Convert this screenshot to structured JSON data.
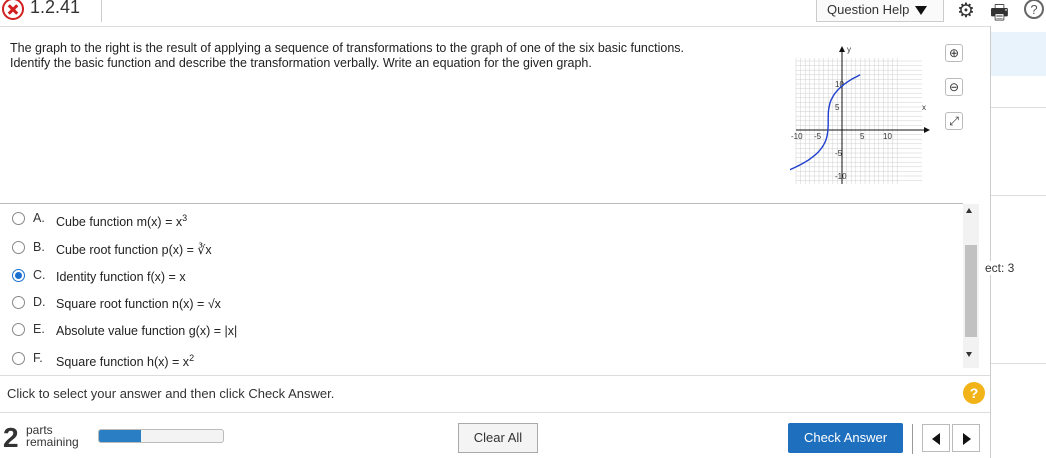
{
  "header": {
    "question_number": "1.2.41",
    "question_help": "Question Help"
  },
  "question": {
    "line1": "The graph to the right is the result of applying a sequence of transformations to the graph of one of the six basic functions.",
    "line2": "Identify the basic function and describe the transformation verbally. Write an equation for the given graph."
  },
  "graph": {
    "x_label": "x",
    "y_label": "y",
    "x_ticks": [
      "-10",
      "-5",
      "5",
      "10"
    ],
    "y_ticks": [
      "10",
      "5",
      "-5",
      "-10"
    ],
    "curve_color": "#1f3fd0"
  },
  "options": [
    {
      "letter": "A.",
      "text": "Cube function m(x) = x",
      "sup": "3",
      "selected": false
    },
    {
      "letter": "B.",
      "text": "Cube root function p(x) = ∛x",
      "sup": "",
      "selected": false
    },
    {
      "letter": "C.",
      "text": "Identity function f(x) = x",
      "sup": "",
      "selected": true
    },
    {
      "letter": "D.",
      "text": "Square root function n(x) = √x",
      "sup": "",
      "selected": false
    },
    {
      "letter": "E.",
      "text": "Absolute value function g(x) = |x|",
      "sup": "",
      "selected": false
    },
    {
      "letter": "F.",
      "text": "Square function h(x) = x",
      "sup": "2",
      "selected": false
    }
  ],
  "instruction": "Click to select your answer and then click Check Answer.",
  "footer": {
    "parts_number": "2",
    "parts_word": "parts",
    "remaining_word": "remaining",
    "progress_fraction": 0.34,
    "clear_all": "Clear All",
    "check_answer": "Check Answer"
  },
  "side_panel": {
    "label": "ect: 3"
  },
  "colors": {
    "accent": "#1f6fbf",
    "error": "#d21f1f",
    "hint": "#f2b318"
  }
}
